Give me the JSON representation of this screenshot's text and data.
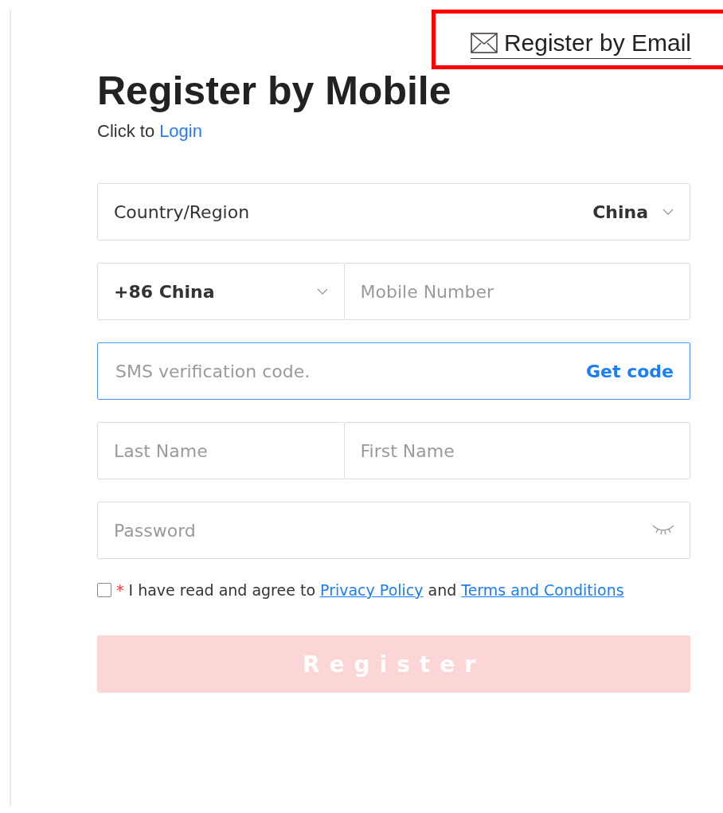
{
  "header_link": {
    "label": "Register by Email",
    "highlighted": true
  },
  "title": "Register by Mobile",
  "login_prompt": {
    "text": "Click to",
    "link": "Login"
  },
  "country": {
    "label": "Country/Region",
    "value": "China"
  },
  "phone": {
    "code": "+86 China",
    "placeholder": "Mobile Number"
  },
  "sms": {
    "placeholder": "SMS verification code.",
    "button": "Get code",
    "focused": true
  },
  "name": {
    "last_placeholder": "Last Name",
    "first_placeholder": "First Name"
  },
  "password": {
    "placeholder": "Password"
  },
  "agreement": {
    "checked": false,
    "required_mark": "*",
    "text": "I have read and agree to",
    "privacy_link": "Privacy Policy ",
    "joiner": "and",
    "terms_link": "Terms and Conditions"
  },
  "register_button": {
    "label": "Register",
    "disabled": true
  }
}
